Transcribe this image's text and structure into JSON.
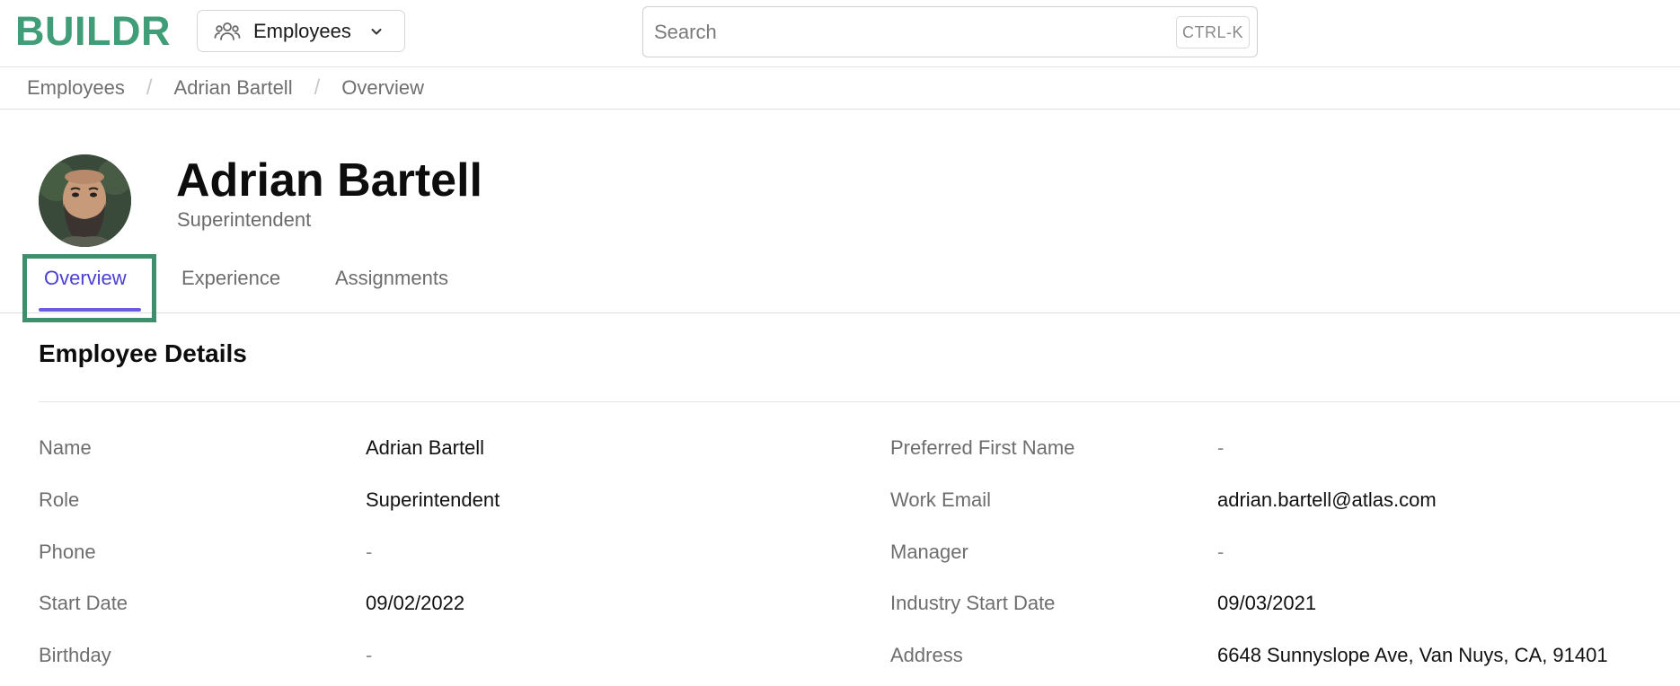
{
  "brand": {
    "logo_text": "BUILDR",
    "color": "#3f9d77"
  },
  "module_select": {
    "label": "Employees",
    "icon": "people-icon"
  },
  "search": {
    "placeholder": "Search",
    "shortcut": "CTRL-K"
  },
  "breadcrumb": [
    "Employees",
    "Adrian Bartell",
    "Overview"
  ],
  "profile": {
    "name": "Adrian Bartell",
    "title": "Superintendent"
  },
  "tabs": [
    {
      "label": "Overview",
      "active": true
    },
    {
      "label": "Experience",
      "active": false
    },
    {
      "label": "Assignments",
      "active": false
    }
  ],
  "section": {
    "title": "Employee Details"
  },
  "details": {
    "left": [
      {
        "label": "Name",
        "value": "Adrian Bartell"
      },
      {
        "label": "Role",
        "value": "Superintendent"
      },
      {
        "label": "Phone",
        "value": "-"
      },
      {
        "label": "Start Date",
        "value": "09/02/2022"
      },
      {
        "label": "Birthday",
        "value": "-"
      }
    ],
    "right": [
      {
        "label": "Preferred First Name",
        "value": "-"
      },
      {
        "label": "Work Email",
        "value": "adrian.bartell@atlas.com"
      },
      {
        "label": "Manager",
        "value": "-"
      },
      {
        "label": "Industry Start Date",
        "value": "09/03/2021"
      },
      {
        "label": "Address",
        "value": "6648 Sunnyslope Ave, Van Nuys, CA, 91401"
      }
    ]
  },
  "colors": {
    "accent": "#4b3fd6",
    "tab_underline": "#6a5ce0",
    "focus_ring": "#3f8f6d"
  }
}
